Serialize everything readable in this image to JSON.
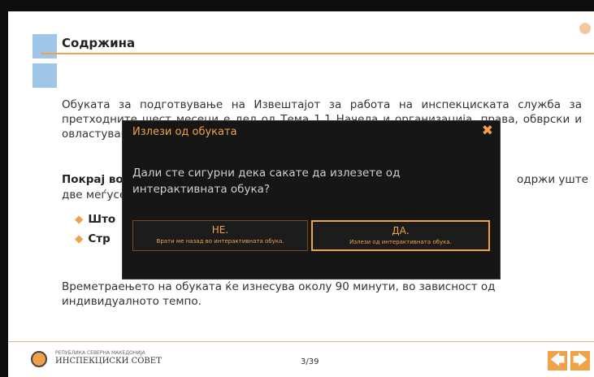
{
  "slide": {
    "title": "Содржина",
    "para1": "Обуката за подготвување на Извештајот за работа на инспекциската служба за претходните шест месеци е дел од Тема 1.1 Начела и организација, права, обврски и овластувања",
    "para2_left": "Покрај во",
    "para2_left_cont": "две меѓусе",
    "para2_right": "одржи уште",
    "bullet1": "Што",
    "bullet2": "Стр",
    "para3_line1": "Времетраењето на обуката ќе изнесува околу 90 минути, во зависност од",
    "para3_line2": "индивидуалното темпо."
  },
  "footer": {
    "org_small": "РЕПУБЛИКА СЕВЕРНА МАКЕДОНИЈА",
    "org_name": "ИНСПЕКЦИСКИ СОВЕТ",
    "page": "3/39"
  },
  "dialog": {
    "title": "Излези од обуката",
    "message": "Дали сте сигурни дека сакате да излезете од интерактивната обука?",
    "no_label": "НЕ.",
    "no_sub": "Врати ме назад во интерактивната обука.",
    "yes_label": "ДА.",
    "yes_sub": "Излези од интерактивната обука."
  },
  "icons": {
    "prev": "arrow-left-icon",
    "next": "arrow-right-icon",
    "close": "close-icon"
  },
  "colors": {
    "accent": "#f0a24a",
    "square": "#9fc6e6",
    "dialog_bg": "#161616"
  }
}
